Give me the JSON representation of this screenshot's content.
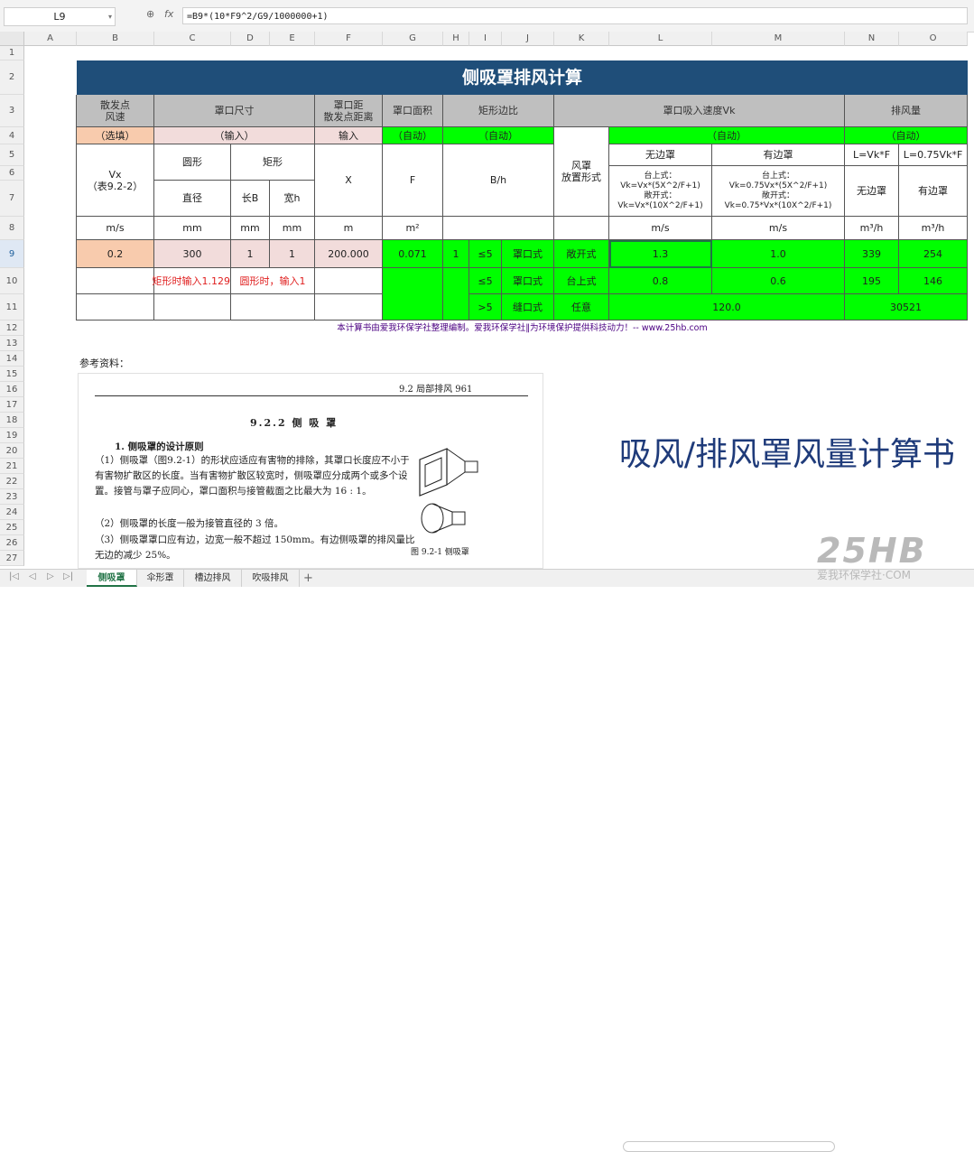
{
  "formula_bar": {
    "name_box": "L9",
    "fx": "fx",
    "zoom_icon": "zoom-icon",
    "formula": "=B9*(10*F9^2/G9/1000000+1)"
  },
  "columns": [
    "A",
    "B",
    "C",
    "D",
    "E",
    "F",
    "G",
    "H",
    "I",
    "J",
    "K",
    "L",
    "M",
    "N",
    "O"
  ],
  "rows": [
    "1",
    "2",
    "3",
    "4",
    "5",
    "6",
    "7",
    "8",
    "9",
    "10",
    "11",
    "12",
    "13",
    "14",
    "15",
    "16",
    "17",
    "18",
    "19",
    "20",
    "21",
    "22",
    "23",
    "24",
    "25",
    "26",
    "27"
  ],
  "sheet": {
    "title": "侧吸罩排风计算",
    "h3": {
      "b": "散发点\n风速",
      "c": "罩口尺寸",
      "f": "罩口距\n散发点距离",
      "g": "罩口面积",
      "h": "矩形边比",
      "k": "罩口吸入速度Vk",
      "n": "排风量"
    },
    "h4": {
      "b": "（选填）",
      "c": "（输入）",
      "f": "输入",
      "g": "（自动）",
      "h": "（自动）",
      "l": "（自动）",
      "n": "（自动）"
    },
    "h5": {
      "b": "Vx\n（表9.2-2）",
      "c": "圆形",
      "d": "矩形",
      "f": "X",
      "g": "F",
      "h": "B/h",
      "k": "风罩\n放置形式",
      "l": "无边罩",
      "m": "有边罩",
      "n": "L=Vk*F",
      "o": "L=0.75Vk*F"
    },
    "h7": {
      "c": "直径",
      "d": "长B",
      "e": "宽h",
      "l": "台上式：\nVk=Vx*(5X^2/F+1)\n敞开式：\nVk=Vx*(10X^2/F+1)",
      "m": "台上式：\nVk=0.75Vx*(5X^2/F+1)\n敞开式：\nVk=0.75*Vx*(10X^2/F+1)",
      "n": "无边罩",
      "o": "有边罩"
    },
    "units": {
      "b": "m/s",
      "c": "mm",
      "d": "mm",
      "e": "mm",
      "f": "m",
      "g": "m²",
      "l": "m/s",
      "m": "m/s",
      "n": "m³/h",
      "o": "m³/h"
    },
    "r9": {
      "b": "0.2",
      "c": "300",
      "d": "1",
      "e": "1",
      "f": "200.000",
      "g": "0.071",
      "h": "1",
      "i": "≤5",
      "j": "罩口式",
      "k": "敞开式",
      "l": "1.3",
      "m": "1.0",
      "n": "339",
      "o": "254"
    },
    "r10": {
      "c": "矩形时输入1.129",
      "d": "圆形时，输入1",
      "i": "≤5",
      "j": "罩口式",
      "k": "台上式",
      "l": "0.8",
      "m": "0.6",
      "n": "195",
      "o": "146"
    },
    "r11": {
      "i": ">5",
      "j": "缝口式",
      "k": "任意",
      "l": "120.0",
      "n": "30521"
    },
    "note": "本计算书由爱我环保学社整理编制。爱我环保学社‖为环境保护提供科技动力！-- www.25hb.com",
    "ref_label": "参考资料："
  },
  "doc": {
    "header": "9.2  局部排风  961",
    "section": "9.2.2  侧  吸  罩",
    "heading": "1. 侧吸罩的设计原则",
    "p1": "（1）侧吸罩（图9.2-1）的形状应适应有害物的排除，其罩口长度应不小于有害物扩散区的长度。当有害物扩散区较宽时，侧吸罩应分成两个或多个设置。接管与罩子应同心，罩口面积与接管截面之比最大为 16 : 1。",
    "p2": "（2）侧吸罩的长度一般为接管直径的 3 倍。",
    "p3": "（3）侧吸罩罩口应有边，边宽一般不超过 150mm。有边侧吸罩的排风量比无边的减少 25%。",
    "caption": "图 9.2-1  侧吸罩"
  },
  "big_title": "吸风/排风罩风量计算书",
  "tabs": [
    "侧吸罩",
    "伞形罩",
    "槽边排风",
    "吹吸排风"
  ],
  "add_tab": "+",
  "watermark": {
    "main": "25HB",
    "sub": "爱我环保学社·COM"
  }
}
